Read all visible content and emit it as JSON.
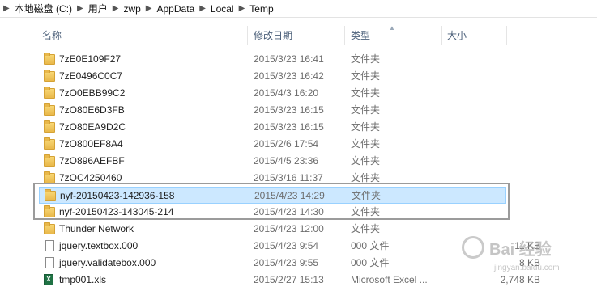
{
  "address": {
    "crumbs": [
      "本地磁盘 (C:)",
      "用户",
      "zwp",
      "AppData",
      "Local",
      "Temp"
    ]
  },
  "columns": {
    "name": "名称",
    "date": "修改日期",
    "type": "类型",
    "size": "大小"
  },
  "files": [
    {
      "name": "7zE0E109F27",
      "date": "2015/3/23 16:41",
      "type": "文件夹",
      "size": "",
      "icon": "folder-icon",
      "selected": false
    },
    {
      "name": "7zE0496C0C7",
      "date": "2015/3/23 16:42",
      "type": "文件夹",
      "size": "",
      "icon": "folder-icon",
      "selected": false
    },
    {
      "name": "7zO0EBB99C2",
      "date": "2015/4/3 16:20",
      "type": "文件夹",
      "size": "",
      "icon": "folder-icon",
      "selected": false
    },
    {
      "name": "7zO80E6D3FB",
      "date": "2015/3/23 16:15",
      "type": "文件夹",
      "size": "",
      "icon": "folder-icon",
      "selected": false
    },
    {
      "name": "7zO80EA9D2C",
      "date": "2015/3/23 16:15",
      "type": "文件夹",
      "size": "",
      "icon": "folder-icon",
      "selected": false
    },
    {
      "name": "7zO800EF8A4",
      "date": "2015/2/6 17:54",
      "type": "文件夹",
      "size": "",
      "icon": "folder-icon",
      "selected": false
    },
    {
      "name": "7zO896AEFBF",
      "date": "2015/4/5 23:36",
      "type": "文件夹",
      "size": "",
      "icon": "folder-icon",
      "selected": false
    },
    {
      "name": "7zOC4250460",
      "date": "2015/3/16 11:37",
      "type": "文件夹",
      "size": "",
      "icon": "folder-icon",
      "selected": false
    },
    {
      "name": "nyf-20150423-142936-158",
      "date": "2015/4/23 14:29",
      "type": "文件夹",
      "size": "",
      "icon": "folder-icon",
      "selected": true
    },
    {
      "name": "nyf-20150423-143045-214",
      "date": "2015/4/23 14:30",
      "type": "文件夹",
      "size": "",
      "icon": "folder-icon",
      "selected": false
    },
    {
      "name": "Thunder Network",
      "date": "2015/4/23 12:00",
      "type": "文件夹",
      "size": "",
      "icon": "folder-icon",
      "selected": false
    },
    {
      "name": "jquery.textbox.000",
      "date": "2015/4/23 9:54",
      "type": "000 文件",
      "size": "11 KB",
      "icon": "file-icon",
      "selected": false
    },
    {
      "name": "jquery.validatebox.000",
      "date": "2015/4/23 9:55",
      "type": "000 文件",
      "size": "8 KB",
      "icon": "file-icon",
      "selected": false
    },
    {
      "name": "tmp001.xls",
      "date": "2015/2/27 15:13",
      "type": "Microsoft Excel ...",
      "size": "2,748 KB",
      "icon": "xls-icon",
      "selected": false
    }
  ],
  "watermark": {
    "text": "Bai 经验",
    "sub": "jingyan.baidu.com"
  }
}
